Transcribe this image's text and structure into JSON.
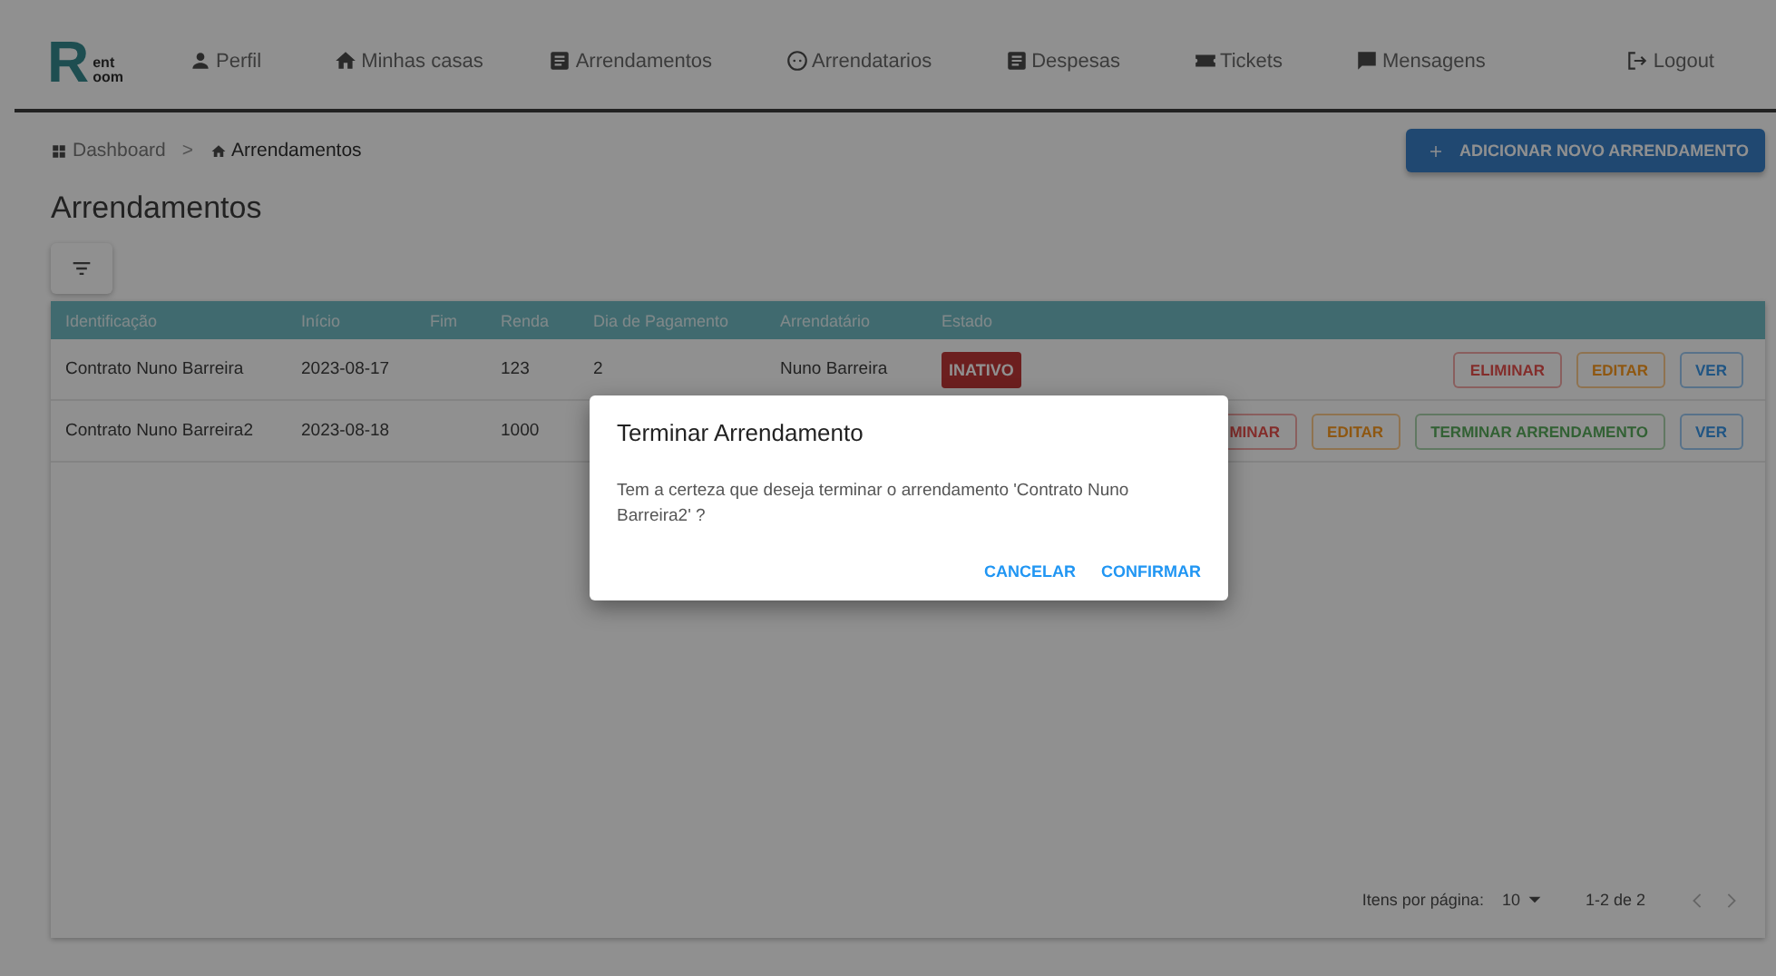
{
  "logo": {
    "letter": "R",
    "line1": "ent",
    "line2": "oom"
  },
  "nav": [
    {
      "kind": "person",
      "label": "Perfil"
    },
    {
      "kind": "home",
      "label": "Minhas casas"
    },
    {
      "kind": "doc",
      "label": "Arrendamentos"
    },
    {
      "kind": "face",
      "label": "Arrendatarios"
    },
    {
      "kind": "doc",
      "label": "Despesas"
    },
    {
      "kind": "ticket",
      "label": "Tickets"
    },
    {
      "kind": "message",
      "label": "Mensagens"
    }
  ],
  "logout": "Logout",
  "breadcrumb": [
    {
      "kind": "grid",
      "label": "Dashboard",
      "current": false
    },
    {
      "kind": "home",
      "label": "Arrendamentos",
      "current": true
    }
  ],
  "breadcrumb_separator": ">",
  "add_button": "ADICIONAR NOVO ARRENDAMENTO",
  "page_title": "Arrendamentos",
  "table": {
    "columns": [
      "Identificação",
      "Início",
      "Fim",
      "Renda",
      "Dia de Pagamento",
      "Arrendatário",
      "Estado"
    ],
    "rows": [
      {
        "cells": [
          "Contrato Nuno Barreira",
          "2023-08-17",
          "",
          "123",
          "2",
          "Nuno Barreira"
        ],
        "status": {
          "label": "INATIVO",
          "kind": "inactive"
        },
        "actions": [
          {
            "label": "ELIMINAR",
            "kind": "danger"
          },
          {
            "label": "EDITAR",
            "kind": "warning"
          },
          {
            "label": "VER",
            "kind": "info"
          }
        ]
      },
      {
        "cells": [
          "Contrato Nuno Barreira2",
          "2023-08-18",
          "",
          "1000"
        ],
        "actions": [
          {
            "label": "MINAR",
            "kind": "danger"
          },
          {
            "label": "EDITAR",
            "kind": "warning"
          },
          {
            "label": "TERMINAR ARRENDAMENTO",
            "kind": "success"
          },
          {
            "label": "VER",
            "kind": "info"
          }
        ]
      }
    ]
  },
  "pagination": {
    "label": "Itens por página:",
    "per_page": "10",
    "range": "1-2 de 2"
  },
  "dialog": {
    "title": "Terminar Arrendamento",
    "message": "Tem a certeza que deseja terminar o arrendamento 'Contrato Nuno Barreira2' ?",
    "buttons": [
      "CANCELAR",
      "CONFIRMAR"
    ]
  }
}
